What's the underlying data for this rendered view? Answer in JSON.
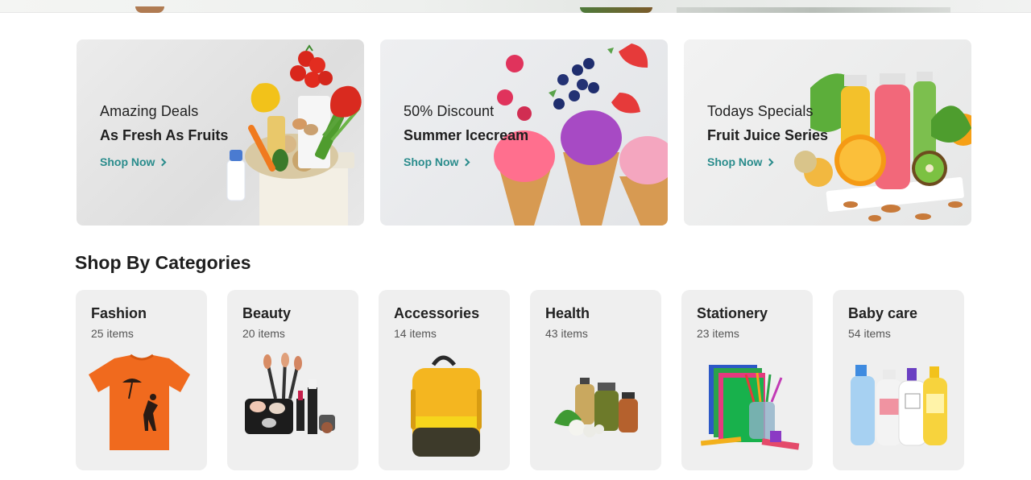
{
  "banners": [
    {
      "kicker": "Amazing Deals",
      "headline": "As Fresh As Fruits",
      "cta": "Shop Now"
    },
    {
      "kicker": "50% Discount",
      "headline": "Summer Icecream",
      "cta": "Shop Now"
    },
    {
      "kicker": "Todays Specials",
      "headline": "Fruit Juice Series",
      "cta": "Shop Now"
    }
  ],
  "section_title": "Shop By Categories",
  "categories": [
    {
      "name": "Fashion",
      "count": "25 items",
      "icon": "tshirt-icon"
    },
    {
      "name": "Beauty",
      "count": "20 items",
      "icon": "makeup-icon"
    },
    {
      "name": "Accessories",
      "count": "14 items",
      "icon": "backpack-icon"
    },
    {
      "name": "Health",
      "count": "43 items",
      "icon": "bottles-icon"
    },
    {
      "name": "Stationery",
      "count": "23 items",
      "icon": "notebooks-icon"
    },
    {
      "name": "Baby care",
      "count": "54 items",
      "icon": "baby-products-icon"
    }
  ],
  "colors": {
    "accent": "#2a8c8c",
    "card_bg": "#efefef",
    "title": "#1e1e1e"
  }
}
